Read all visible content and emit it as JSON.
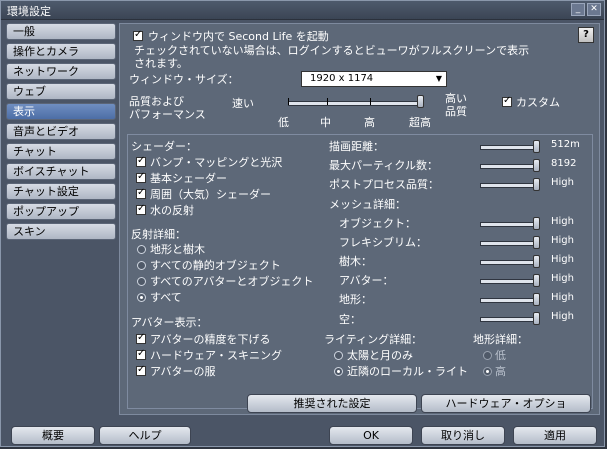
{
  "window": {
    "title": "環境設定"
  },
  "sidebar": {
    "items": [
      {
        "label": "一般"
      },
      {
        "label": "操作とカメラ"
      },
      {
        "label": "ネットワーク"
      },
      {
        "label": "ウェブ"
      },
      {
        "label": "表示",
        "active": true
      },
      {
        "label": "音声とビデオ"
      },
      {
        "label": "チャット"
      },
      {
        "label": "ボイスチャット"
      },
      {
        "label": "チャット設定"
      },
      {
        "label": "ポップアップ"
      },
      {
        "label": "スキン"
      }
    ]
  },
  "display": {
    "window_startup_label": "ウィンドウ内で Second Life を起動",
    "window_startup_note_1": "チェックされていない場合は、ログインするとビューワがフルスクリーンで表示",
    "window_startup_note_2": "されます。",
    "help_label": "?",
    "window_size_label": "ウィンドウ・サイズ：",
    "window_size_value": "1920 x 1174",
    "quality_label_1": "品質および",
    "quality_label_2": "パフォーマンス",
    "fast_label": "速い",
    "high_quality_1": "高い",
    "high_quality_2": "品質",
    "custom_label": "カスタム",
    "quality_ticks": [
      "低",
      "中",
      "高",
      "超高"
    ],
    "quality_level": 1.0,
    "shaders_title": "シェーダー：",
    "shaders": [
      {
        "label": "バンプ・マッピングと光沢",
        "checked": true
      },
      {
        "label": "基本シェーダー",
        "checked": true
      },
      {
        "label": "周囲（大気）シェーダー",
        "checked": true
      },
      {
        "label": "水の反射",
        "checked": true
      }
    ],
    "reflection_title": "反射詳細：",
    "reflections": [
      {
        "label": "地形と樹木",
        "selected": false
      },
      {
        "label": "すべての静的オブジェクト",
        "selected": false
      },
      {
        "label": "すべてのアバターとオブジェクト",
        "selected": false
      },
      {
        "label": "すべて",
        "selected": true
      }
    ],
    "avatar_title": "アバター表示：",
    "avatar_options": [
      {
        "label": "アバターの精度を下げる",
        "checked": true
      },
      {
        "label": "ハードウェア・スキニング",
        "checked": true
      },
      {
        "label": "アバターの服",
        "checked": true
      }
    ],
    "draw_distance_label": "描画距離：",
    "draw_distance_value": "512m",
    "draw_distance_level": 1.0,
    "max_particles_label": "最大パーティクル数：",
    "max_particles_value": "8192",
    "max_particles_level": 1.0,
    "post_process_label": "ポストプロセス品質：",
    "post_process_value": "High",
    "post_process_level": 1.0,
    "mesh_title": "メッシュ詳細：",
    "mesh_items": [
      {
        "label": "オブジェクト：",
        "value": "High",
        "level": 1.0
      },
      {
        "label": "フレキシブリム：",
        "value": "High",
        "level": 1.0
      },
      {
        "label": "樹木：",
        "value": "High",
        "level": 1.0
      },
      {
        "label": "アバター：",
        "value": "High",
        "level": 1.0
      },
      {
        "label": "地形：",
        "value": "High",
        "level": 1.0
      },
      {
        "label": "空：",
        "value": "High",
        "level": 1.0
      }
    ],
    "lighting_title": "ライティング詳細：",
    "lighting": [
      {
        "label": "太陽と月のみ",
        "selected": false
      },
      {
        "label": "近隣のローカル・ライト",
        "selected": true
      }
    ],
    "terrain_title": "地形詳細：",
    "terrain": [
      {
        "label": "低",
        "selected": false
      },
      {
        "label": "高",
        "selected": true
      }
    ],
    "recommended_button": "推奨された設定",
    "hardware_button": "ハードウェア・オプショ"
  },
  "footer": {
    "about": "概要",
    "help": "ヘルプ",
    "ok": "OK",
    "cancel": "取り消し",
    "apply": "適用"
  }
}
